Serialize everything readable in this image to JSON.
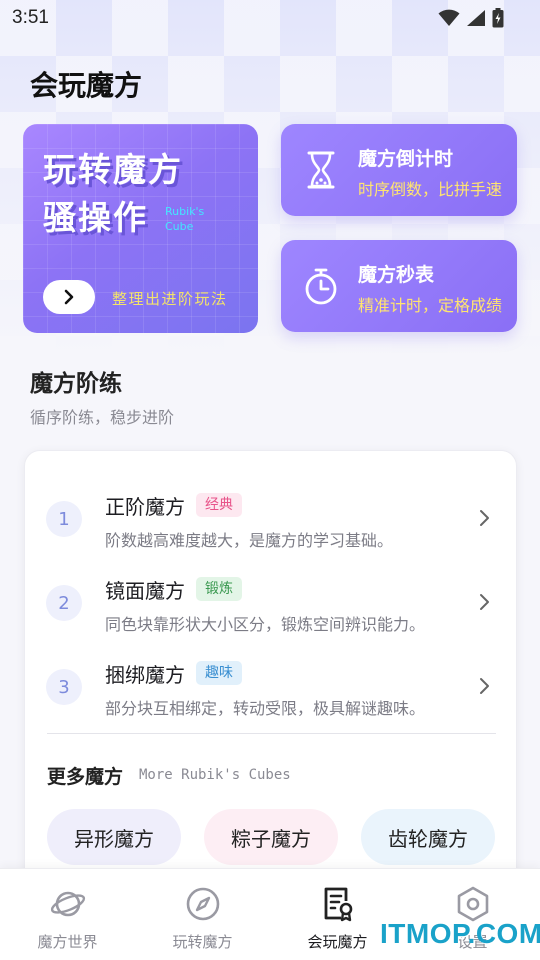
{
  "status_bar": {
    "time": "3:51"
  },
  "page": {
    "title": "会玩魔方"
  },
  "hero": {
    "title_line1": "玩转魔方",
    "title_line2": "骚操作",
    "subtitle_line1": "Rubik's",
    "subtitle_line2": "Cube",
    "caption": "整理出进阶玩法"
  },
  "tools": [
    {
      "title": "魔方倒计时",
      "subtitle": "时序倒数，比拼手速",
      "icon": "hourglass-icon"
    },
    {
      "title": "魔方秒表",
      "subtitle": "精准计时，定格成绩",
      "icon": "stopwatch-icon"
    }
  ],
  "section": {
    "title": "魔方阶练",
    "subtitle": "循序阶练，稳步进阶"
  },
  "levels": [
    {
      "num": "1",
      "name": "正阶魔方",
      "tag": "经典",
      "tag_color": "#e8548a",
      "tag_bg": "#fde8f0",
      "desc": "阶数越高难度越大，是魔方的学习基础。"
    },
    {
      "num": "2",
      "name": "镜面魔方",
      "tag": "锻炼",
      "tag_color": "#3c9a52",
      "tag_bg": "#e3f5e7",
      "desc": "同色块靠形状大小区分，锻炼空间辨识能力。"
    },
    {
      "num": "3",
      "name": "捆绑魔方",
      "tag": "趣味",
      "tag_color": "#3a8fd1",
      "tag_bg": "#e1f0fb",
      "desc": "部分块互相绑定，转动受限，极具解谜趣味。"
    }
  ],
  "more": {
    "title": "更多魔方",
    "subtitle": "More Rubik's Cubes",
    "items": [
      {
        "label": "异形魔方",
        "bg": "#efeefb"
      },
      {
        "label": "粽子魔方",
        "bg": "#fdeef4"
      },
      {
        "label": "齿轮魔方",
        "bg": "#eaf4fc"
      }
    ]
  },
  "nav": [
    {
      "label": "魔方世界",
      "icon": "planet-icon",
      "active": false
    },
    {
      "label": "玩转魔方",
      "icon": "compass-icon",
      "active": false
    },
    {
      "label": "会玩魔方",
      "icon": "certificate-icon",
      "active": true
    },
    {
      "label": "设置",
      "icon": "settings-hexagon-icon",
      "active": false
    }
  ],
  "watermark": "ITMOP.COM",
  "colors": {
    "accent": "#8a6ff5",
    "highlight": "#ffe470"
  }
}
